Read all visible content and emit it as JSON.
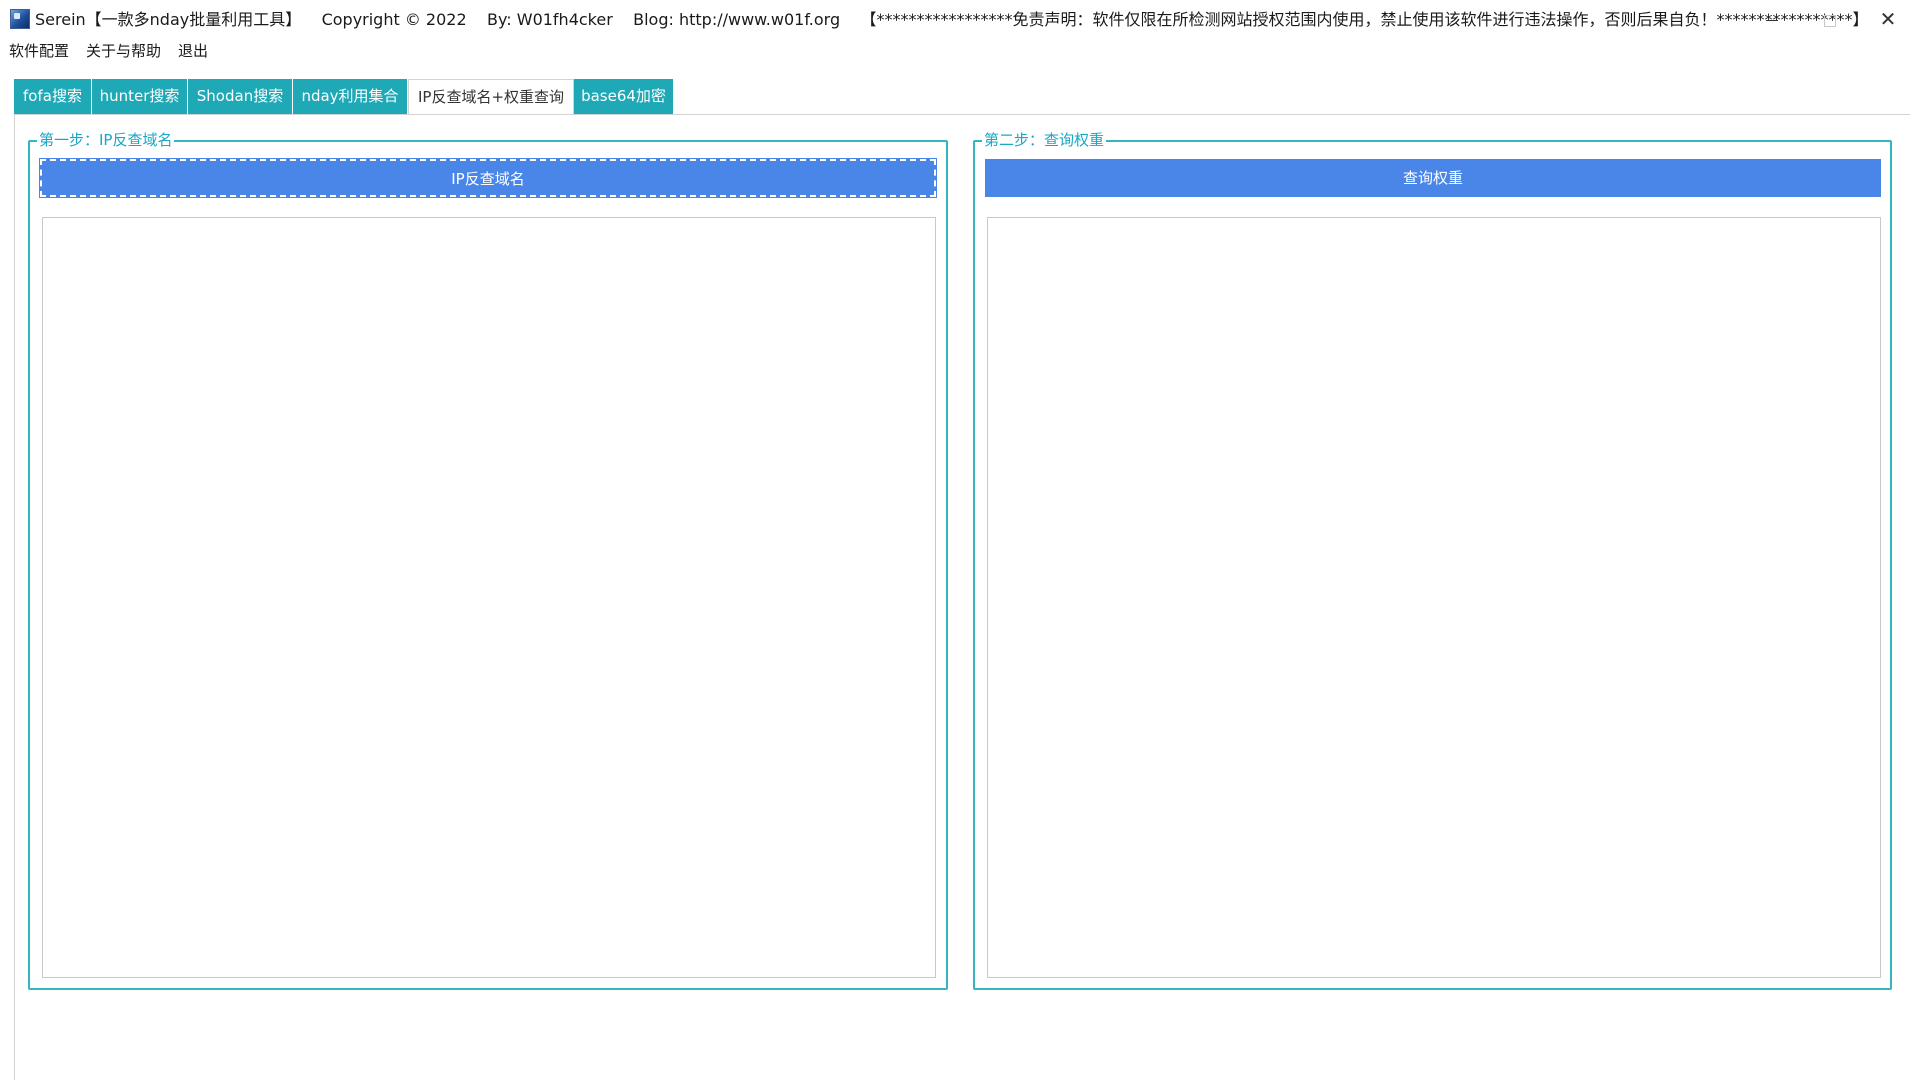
{
  "window": {
    "title": "Serein【一款多nday批量利用工具】    Copyright © 2022    By: W01fh4cker    Blog: http://www.w01f.org    【*****************免责声明：软件仅限在所检测网站授权范围内使用，禁止使用该软件进行违法操作，否则后果自负！*****************】",
    "icon": "app-icon",
    "controls": {
      "minimize_icon": "minimize-icon",
      "maximize_icon": "maximize-icon",
      "close_icon": "close-icon",
      "close_glyph": "✕"
    }
  },
  "menu": {
    "items": [
      "软件配置",
      "关于与帮助",
      "退出"
    ]
  },
  "tabs": {
    "items": [
      "fofa搜索",
      "hunter搜索",
      "Shodan搜索",
      "nday利用集合",
      "IP反查域名+权重查询",
      "base64加密"
    ],
    "active_index": 4,
    "active_color": "#ffffff",
    "inactive_color": "#1fa8b6"
  },
  "step1": {
    "title": "第一步：IP反查域名",
    "button_label": "IP反查域名",
    "output_value": ""
  },
  "step2": {
    "title": "第二步：查询权重",
    "button_label": "查询权重",
    "output_value": ""
  },
  "colors": {
    "accent": "#4a86e8",
    "group_border": "#35b5be",
    "group_title": "#1aa7c5"
  }
}
